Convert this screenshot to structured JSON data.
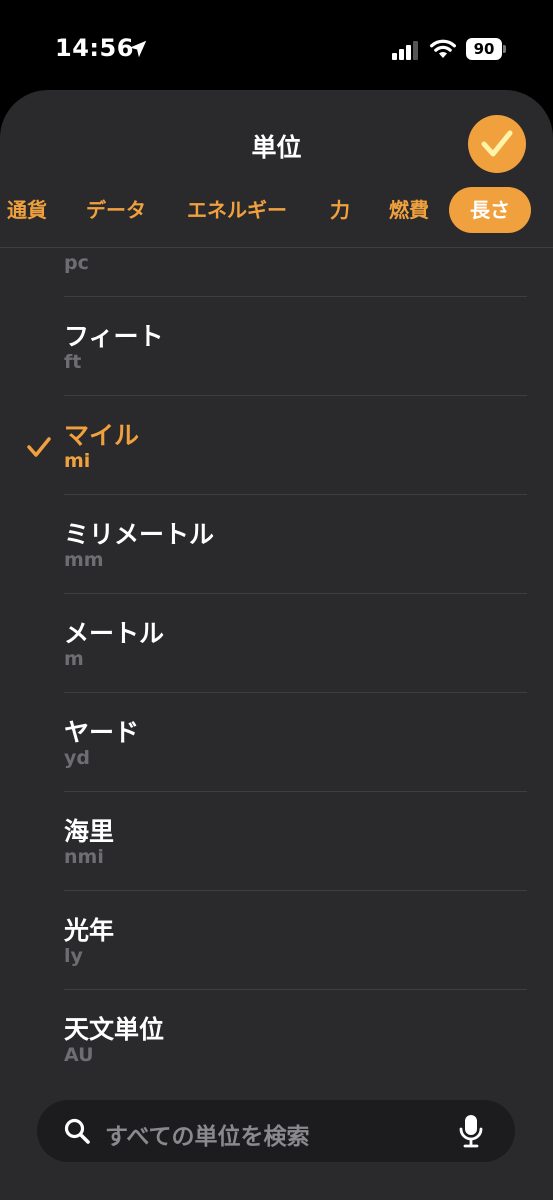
{
  "status": {
    "time": "14:56",
    "battery": "90"
  },
  "sheet": {
    "title": "単位"
  },
  "tabs": [
    {
      "label": "通貨"
    },
    {
      "label": "データ"
    },
    {
      "label": "エネルギー"
    },
    {
      "label": "力"
    },
    {
      "label": "燃費"
    },
    {
      "label": "長さ",
      "active": true
    }
  ],
  "units": [
    {
      "abbr": "pc"
    },
    {
      "name": "フィート",
      "abbr": "ft"
    },
    {
      "name": "マイル",
      "abbr": "mi",
      "selected": true
    },
    {
      "name": "ミリメートル",
      "abbr": "mm"
    },
    {
      "name": "メートル",
      "abbr": "m"
    },
    {
      "name": "ヤード",
      "abbr": "yd"
    },
    {
      "name": "海里",
      "abbr": "nmi"
    },
    {
      "name": "光年",
      "abbr": "ly"
    },
    {
      "name": "天文単位",
      "abbr": "AU"
    }
  ],
  "search": {
    "placeholder": "すべての単位を検索"
  },
  "colors": {
    "accent": "#f0a13e",
    "sheet_bg": "#2a2a2c",
    "secondary_text": "#6e6e72"
  }
}
